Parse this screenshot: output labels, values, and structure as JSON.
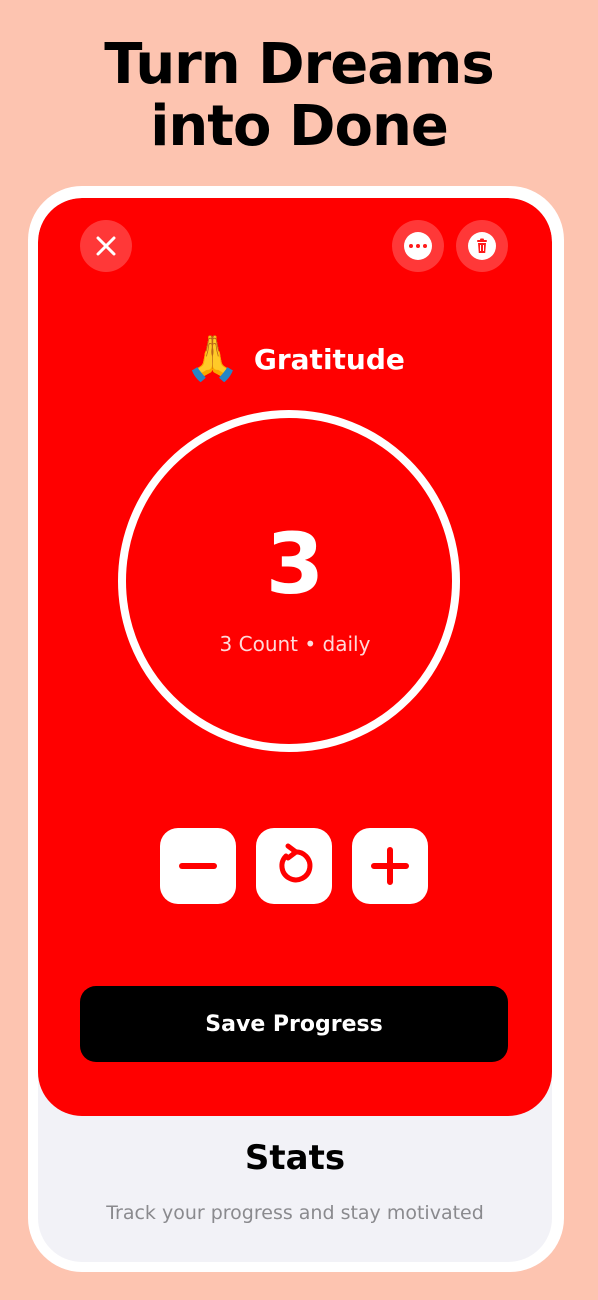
{
  "headline": {
    "line1": "Turn Dreams",
    "line2": "into Done"
  },
  "header": {
    "close_icon": "close-icon",
    "more_icon": "ellipsis-icon",
    "delete_icon": "trash-icon"
  },
  "habit": {
    "emoji": "🙏",
    "name": "Gratitude",
    "count": "3",
    "subtitle": "3 Count • daily"
  },
  "controls": {
    "decrement_icon": "minus-icon",
    "reset_icon": "reset-icon",
    "increment_icon": "plus-icon"
  },
  "save_label": "Save Progress",
  "stats": {
    "title": "Stats",
    "subtitle": "Track your progress and stay motivated"
  },
  "colors": {
    "background": "#FDC4B0",
    "card": "#FF0000",
    "button": "#000000"
  }
}
